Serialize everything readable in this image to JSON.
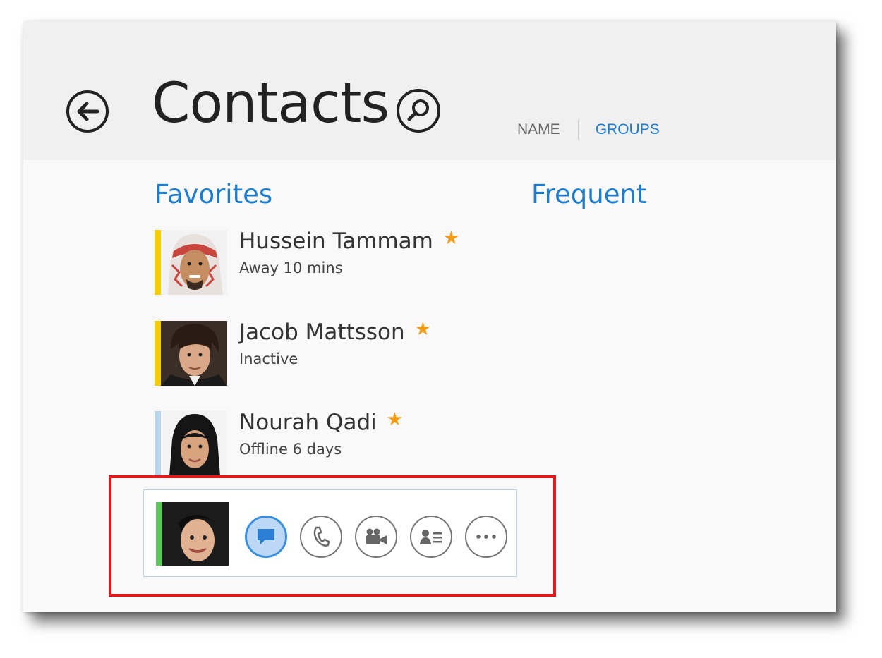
{
  "header": {
    "title": "Contacts",
    "tabs": {
      "name": "NAME",
      "groups": "GROUPS"
    }
  },
  "sections": {
    "favorites": "Favorites",
    "frequent": "Frequent"
  },
  "contacts": [
    {
      "name": "Hussein Tammam",
      "status": "Away 10 mins",
      "presence_color": "#f5cc00",
      "favorite": true
    },
    {
      "name": "Jacob Mattsson",
      "status": "Inactive",
      "presence_color": "#f5cc00",
      "favorite": true
    },
    {
      "name": "Nourah Qadi",
      "status": "Offline 6 days",
      "presence_color": "#b9d4e8",
      "favorite": true
    }
  ],
  "quick_actions": {
    "presence_color": "#5bc659",
    "buttons": [
      "chat-icon",
      "phone-icon",
      "video-icon",
      "contact-card-icon",
      "more-icon"
    ]
  },
  "colors": {
    "accent": "#1e7ccf",
    "star": "#f29b12",
    "highlight": "#e8161b"
  }
}
